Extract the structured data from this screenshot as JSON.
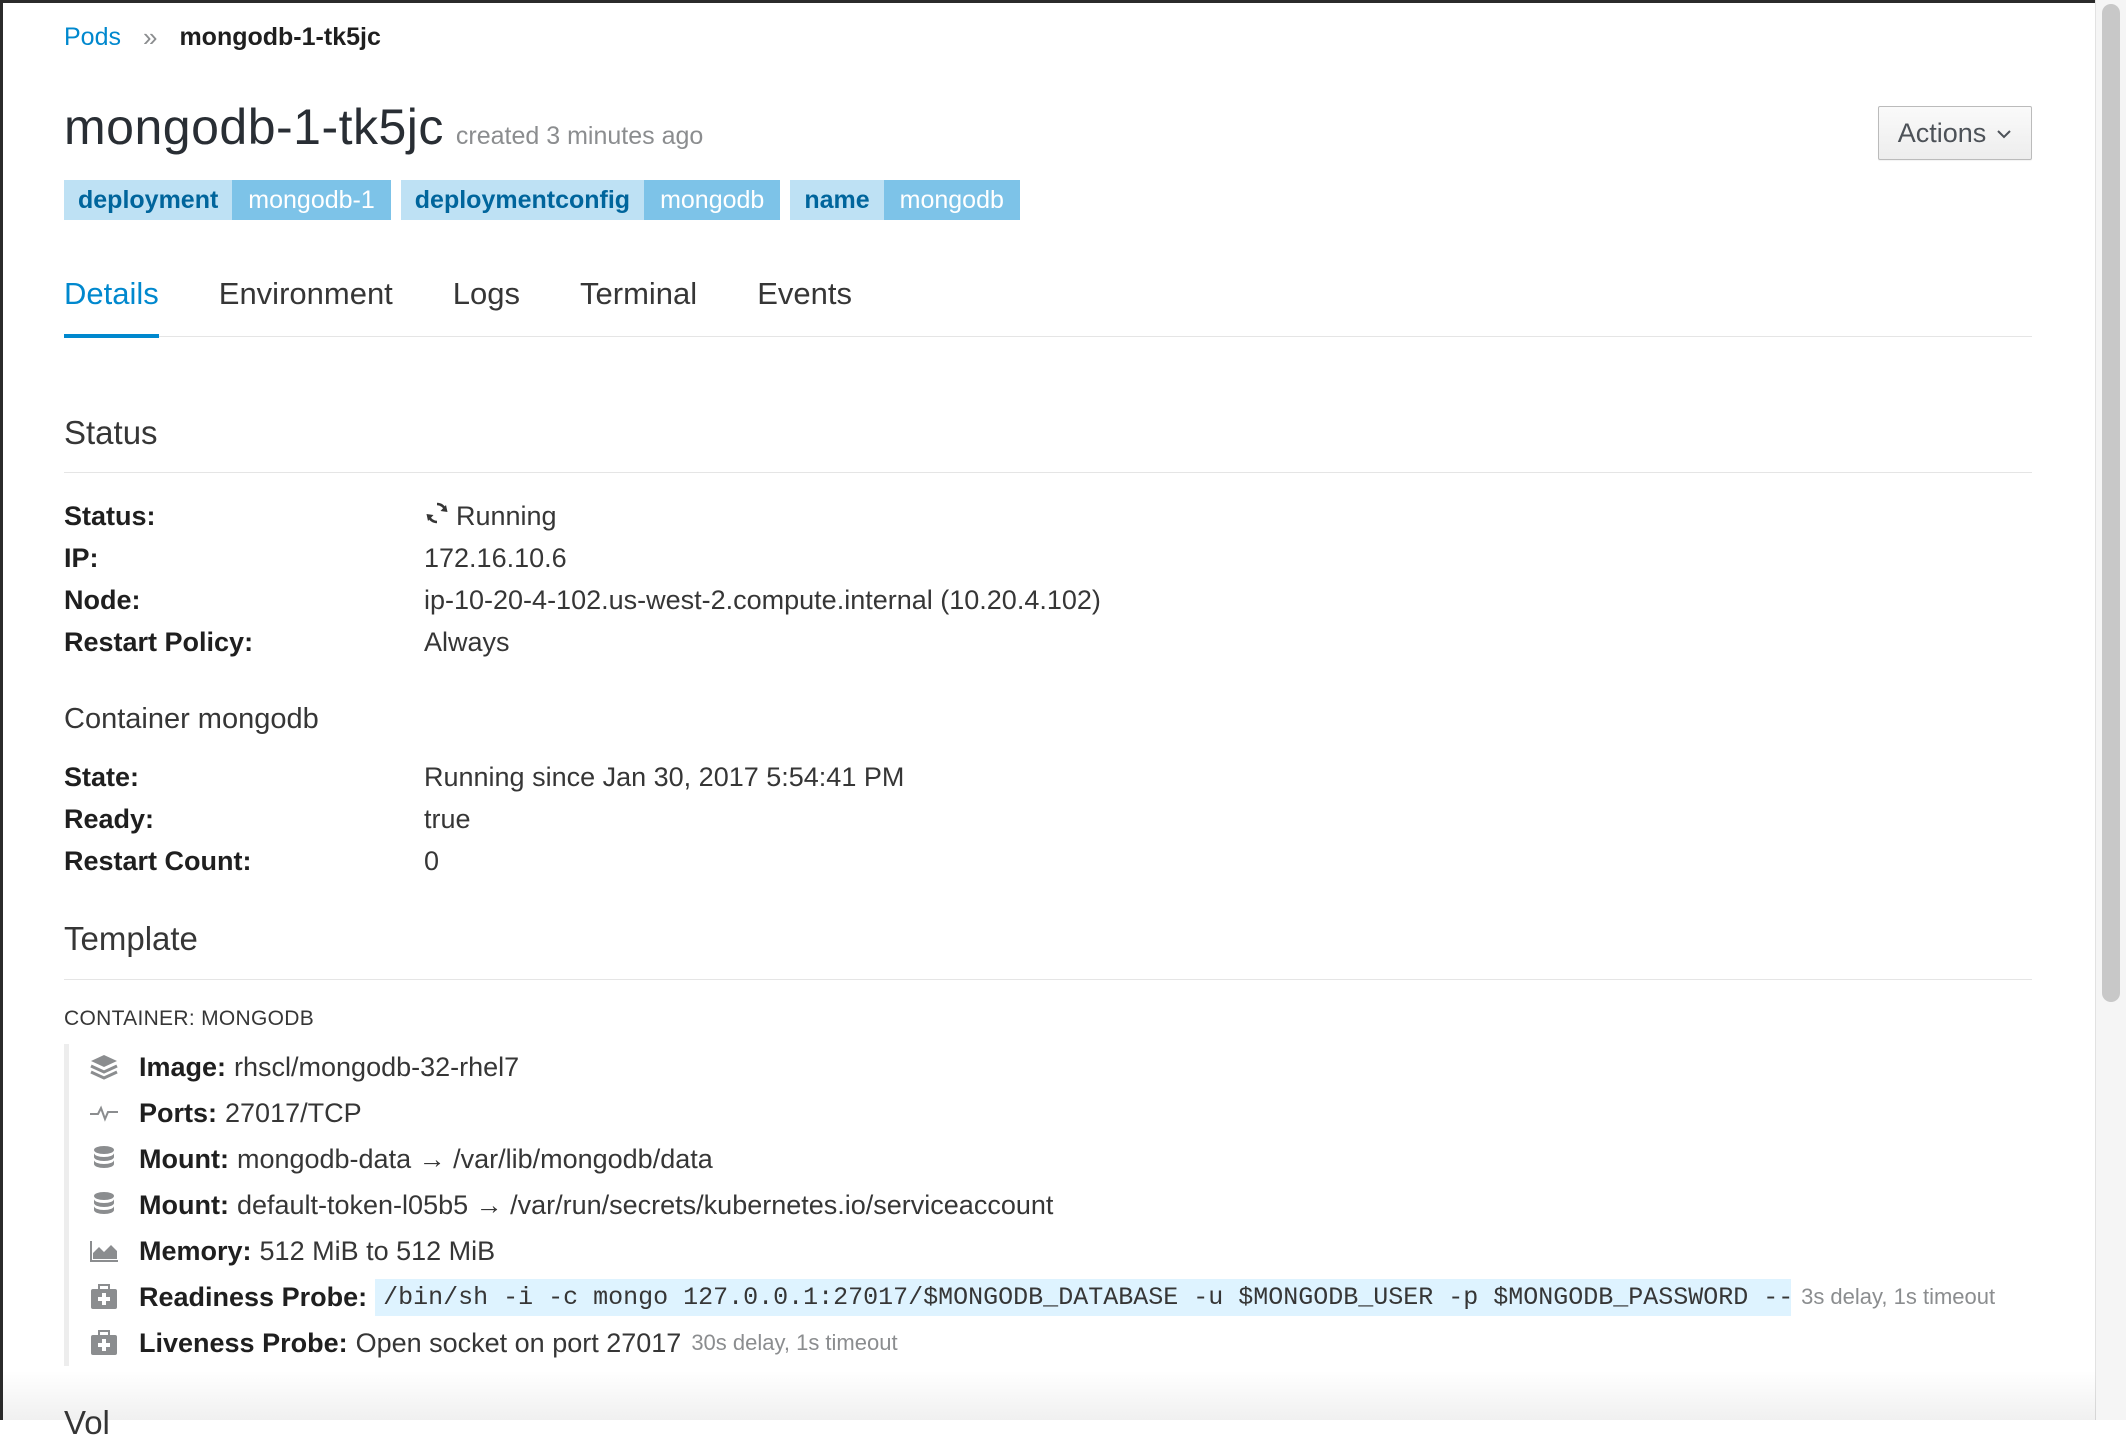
{
  "breadcrumb": {
    "parent": "Pods",
    "separator": "»",
    "current": "mongodb-1-tk5jc"
  },
  "header": {
    "title": "mongodb-1-tk5jc",
    "created": "created 3 minutes ago",
    "actions_label": "Actions"
  },
  "labels": [
    {
      "key": "deployment",
      "value": "mongodb-1"
    },
    {
      "key": "deploymentconfig",
      "value": "mongodb"
    },
    {
      "key": "name",
      "value": "mongodb"
    }
  ],
  "tabs": [
    {
      "label": "Details",
      "active": true
    },
    {
      "label": "Environment",
      "active": false
    },
    {
      "label": "Logs",
      "active": false
    },
    {
      "label": "Terminal",
      "active": false
    },
    {
      "label": "Events",
      "active": false
    }
  ],
  "status_section": {
    "title": "Status",
    "rows": [
      {
        "label": "Status:",
        "value": "Running"
      },
      {
        "label": "IP:",
        "value": "172.16.10.6"
      },
      {
        "label": "Node:",
        "value": "ip-10-20-4-102.us-west-2.compute.internal (10.20.4.102)"
      },
      {
        "label": "Restart Policy:",
        "value": "Always"
      }
    ]
  },
  "container_section": {
    "title": "Container mongodb",
    "rows": [
      {
        "label": "State:",
        "value": "Running since Jan 30, 2017 5:54:41 PM"
      },
      {
        "label": "Ready:",
        "value": "true"
      },
      {
        "label": "Restart Count:",
        "value": "0"
      }
    ]
  },
  "template_section": {
    "title": "Template",
    "container_heading": "CONTAINER: MONGODB",
    "items": [
      {
        "icon": "image-layers-icon",
        "label": "Image:",
        "value": "rhscl/mongodb-32-rhel7"
      },
      {
        "icon": "port-pulse-icon",
        "label": "Ports:",
        "value": "27017/TCP"
      },
      {
        "icon": "database-icon",
        "label": "Mount:",
        "value": "mongodb-data → /var/lib/mongodb/data"
      },
      {
        "icon": "database-icon",
        "label": "Mount:",
        "value": "default-token-l05b5 → /var/run/secrets/kubernetes.io/serviceaccount"
      },
      {
        "icon": "area-chart-icon",
        "label": "Memory:",
        "value": "512 MiB to 512 MiB"
      },
      {
        "icon": "medkit-icon",
        "label": "Readiness Probe:",
        "code": "/bin/sh -i -c mongo 127.0.0.1:27017/$MONGODB_DATABASE -u $MONGODB_USER -p $MONGODB_PASSWORD --…",
        "meta": "3s delay, 1s timeout"
      },
      {
        "icon": "medkit-icon",
        "label": "Liveness Probe:",
        "value": "Open socket on port 27017",
        "meta": "30s delay, 1s timeout"
      }
    ]
  },
  "truncated_next_heading": "Vol",
  "colors": {
    "accent": "#0088ce",
    "label_key_bg": "#bee1f4",
    "label_value_bg": "#7dc3e8",
    "code_bg": "#def3ff"
  }
}
